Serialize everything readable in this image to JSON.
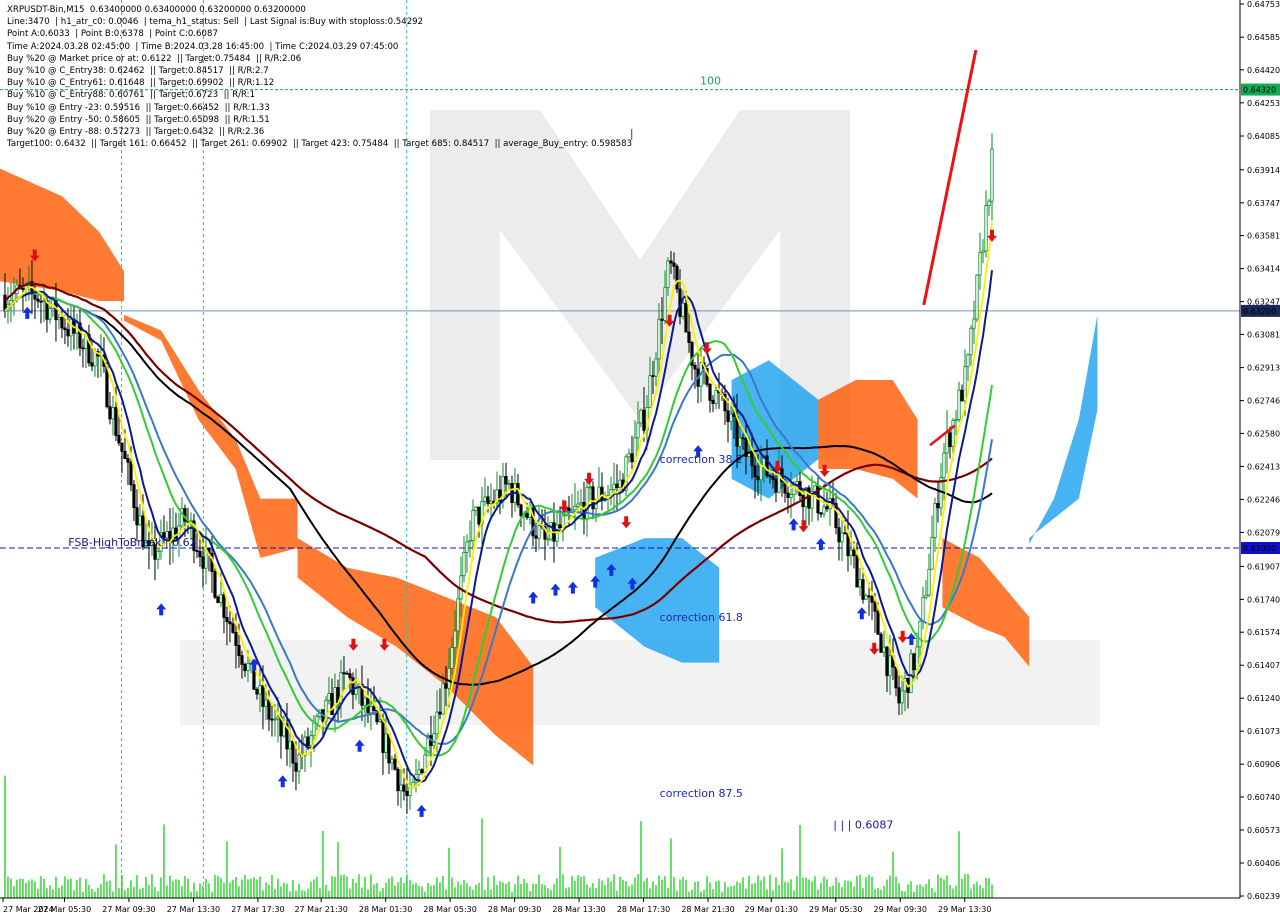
{
  "header": {
    "lines": [
      "XRPUSDT-Bin,M15  0.63400000 0.63400000 0.63200000 0.63200000",
      "Line:3470  | h1_atr_c0: 0.0046  | tema_h1_status: Sell  | Last Signal is:Buy with stoploss:0.54292",
      "Point A:0.6033  | Point B:0.6378  | Point C:0.6087",
      "Time A:2024.03.28 02:45:00  | Time B:2024.03.28 16:45:00  | Time C:2024.03.29 07:45:00",
      "Buy %20 @ Market price or at: 0.6122  || Target:0.75484  || R/R:2.06",
      "Buy %10 @ C_Entry38: 0.62462  || Target:0.84517  || R/R:2.7",
      "Buy %10 @ C_Entry61: 0.61648  || Target:0.69902  || R/R:1.12",
      "Buy %10 @ C_Entry88: 0.60761  || Target:0.6723  || R/R:1",
      "Buy %10 @ Entry -23: 0.59516  || Target:0.66452  || R/R:1.33",
      "Buy %20 @ Entry -50: 0.58605  || Target:0.65098  || R/R:1.51",
      "Buy %20 @ Entry -88: 0.57273  || Target:0.6432  || R/R:2.36",
      "Target100: 0.6432  || Target 161: 0.66452  || Target 261: 0.69902  || Target 423: 0.75484  || Target 685: 0.84517  || average_Buy_entry: 0.598583"
    ]
  },
  "colors": {
    "bull": "#0a8a2a",
    "bear": "#000000",
    "ma_black": "#000000",
    "ma_darkred": "#7a0000",
    "ma_navy": "#0c1a8c",
    "ma_yellow": "#ffee00",
    "ma_green": "#33cc33",
    "ma_steel": "#3a78c8",
    "cloud_orange": "#ff5a00",
    "cloud_blue": "#1aa0f0",
    "arrow_up": "#1030e0",
    "arrow_down": "#e01010",
    "price_line": "#6f8fb5",
    "target_line": "#11aa55",
    "fsb_line": "#1010cc",
    "volume": "#00cc00",
    "watermark": "#cfcfcf"
  },
  "chart_data": {
    "type": "candlestick",
    "symbol": "XRPUSDT-Bin",
    "timeframe": "M15",
    "ylim": [
      0.60239,
      0.64753
    ],
    "y_ticks": [
      0.64753,
      0.64585,
      0.6442,
      0.64253,
      0.64085,
      0.63914,
      0.63747,
      0.63581,
      0.63414,
      0.63247,
      0.63081,
      0.62913,
      0.62746,
      0.6258,
      0.62413,
      0.62246,
      0.62079,
      0.61907,
      0.6174,
      0.61574,
      0.61407,
      0.6124,
      0.61073,
      0.60906,
      0.6074,
      0.60573,
      0.60406,
      0.60239
    ],
    "y_tick_labels": [
      "0.64753",
      "0.64585",
      "0.64420",
      "0.64253",
      "0.64085",
      "0.63914",
      "0.63747",
      "0.63581",
      "0.63414",
      "0.63247",
      "0.63081",
      "0.62913",
      "0.62746",
      "0.62580",
      "0.62413",
      "0.62246",
      "0.62079",
      "0.61907",
      "0.61740",
      "0.61574",
      "0.61407",
      "0.61240",
      "0.61073",
      "0.60906",
      "0.60740",
      "0.60573",
      "0.60406",
      "0.60239"
    ],
    "x_labels": [
      "27 Mar 2024",
      "27 Mar 05:30",
      "27 Mar 09:30",
      "27 Mar 13:30",
      "27 Mar 17:30",
      "27 Mar 21:30",
      "28 Mar 01:30",
      "28 Mar 05:30",
      "28 Mar 09:30",
      "28 Mar 13:30",
      "28 Mar 17:30",
      "28 Mar 21:30",
      "29 Mar 01:30",
      "29 Mar 05:30",
      "29 Mar 09:30",
      "29 Mar 13:30"
    ],
    "current_price": 0.632,
    "current_price_label": "0.63200",
    "target_line": {
      "value": 0.6432,
      "label": "0.64320",
      "text": "100"
    },
    "fsb_line": {
      "value": 0.62,
      "label": "0.62000",
      "text": "FSB-HighToBreak | 0.62"
    },
    "annotations": [
      {
        "text": "correction 38.2",
        "value": 0.6243
      },
      {
        "text": "correction 61.8",
        "value": 0.6163
      },
      {
        "text": "correction 87.5",
        "value": 0.6074
      },
      {
        "text": "| | | 0.6087",
        "value": 0.6058
      },
      {
        "text": "|",
        "value": 0.6408
      }
    ],
    "key_prices": [
      {
        "x": 0.03,
        "close": 0.6328
      },
      {
        "x": 0.08,
        "close": 0.6295
      },
      {
        "x": 0.12,
        "close": 0.6195
      },
      {
        "x": 0.15,
        "close": 0.6215
      },
      {
        "x": 0.17,
        "close": 0.6188
      },
      {
        "x": 0.21,
        "close": 0.6123
      },
      {
        "x": 0.24,
        "close": 0.6092
      },
      {
        "x": 0.28,
        "close": 0.6135
      },
      {
        "x": 0.31,
        "close": 0.6102
      },
      {
        "x": 0.33,
        "close": 0.607
      },
      {
        "x": 0.36,
        "close": 0.6135
      },
      {
        "x": 0.38,
        "close": 0.6213
      },
      {
        "x": 0.41,
        "close": 0.6232
      },
      {
        "x": 0.44,
        "close": 0.6202
      },
      {
        "x": 0.47,
        "close": 0.6222
      },
      {
        "x": 0.5,
        "close": 0.6232
      },
      {
        "x": 0.52,
        "close": 0.6268
      },
      {
        "x": 0.54,
        "close": 0.6344
      },
      {
        "x": 0.56,
        "close": 0.6292
      },
      {
        "x": 0.58,
        "close": 0.6275
      },
      {
        "x": 0.6,
        "close": 0.6248
      },
      {
        "x": 0.62,
        "close": 0.6238
      },
      {
        "x": 0.65,
        "close": 0.6228
      },
      {
        "x": 0.67,
        "close": 0.6218
      },
      {
        "x": 0.69,
        "close": 0.619
      },
      {
        "x": 0.71,
        "close": 0.6155
      },
      {
        "x": 0.725,
        "close": 0.6122
      },
      {
        "x": 0.74,
        "close": 0.6148
      },
      {
        "x": 0.76,
        "close": 0.6245
      },
      {
        "x": 0.78,
        "close": 0.6289
      },
      {
        "x": 0.8,
        "close": 0.6395
      },
      {
        "x": 0.815,
        "close": 0.6365
      },
      {
        "x": 0.825,
        "close": 0.632
      }
    ]
  }
}
